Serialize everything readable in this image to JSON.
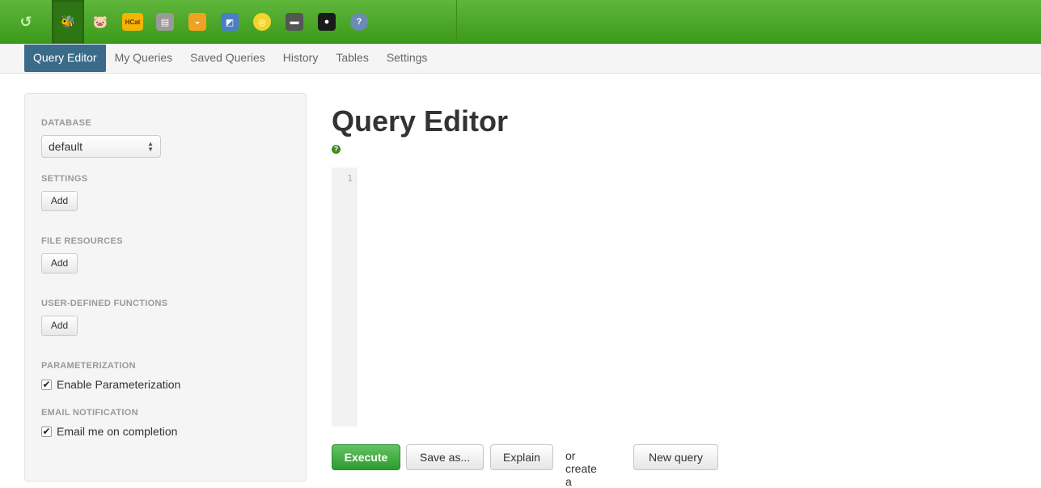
{
  "app_icons": [
    {
      "name": "hue-logo-icon",
      "glyph": "↺",
      "color": "#2e7514"
    },
    {
      "name": "beeswax-icon",
      "glyph": "🐝",
      "color": "#f2c500",
      "active": true
    },
    {
      "name": "pig-icon",
      "glyph": "🐷",
      "color": "#f59fb8"
    },
    {
      "name": "hcat-icon",
      "glyph": "HCat",
      "color": "#f5b400"
    },
    {
      "name": "file-browser-icon",
      "glyph": "▤",
      "color": "#9a9a9a"
    },
    {
      "name": "job-designer-icon",
      "glyph": "◒",
      "color": "#f1a21f"
    },
    {
      "name": "oozie-icon",
      "glyph": "◩",
      "color": "#4a7fc5"
    },
    {
      "name": "job-browser-icon",
      "glyph": "◎",
      "color": "#f3d42c"
    },
    {
      "name": "shell-icon",
      "glyph": "▬",
      "color": "#555555"
    },
    {
      "name": "user-admin-icon",
      "glyph": "●",
      "color": "#1a1a1a"
    },
    {
      "name": "help-icon",
      "glyph": "?",
      "color": "#6a8bb5"
    }
  ],
  "nav": {
    "tabs": [
      "Query Editor",
      "My Queries",
      "Saved Queries",
      "History",
      "Tables",
      "Settings"
    ],
    "active_index": 0
  },
  "sidebar": {
    "database_label": "DATABASE",
    "database_value": "default",
    "settings_label": "SETTINGS",
    "settings_add": "Add",
    "file_resources_label": "FILE RESOURCES",
    "file_resources_add": "Add",
    "udf_label": "USER-DEFINED FUNCTIONS",
    "udf_add": "Add",
    "parameterization_label": "PARAMETERIZATION",
    "parameterization_option": "Enable Parameterization",
    "parameterization_checked": true,
    "email_label": "EMAIL NOTIFICATION",
    "email_option": "Email me on completion",
    "email_checked": true
  },
  "main": {
    "title": "Query Editor",
    "editor_line_number": "1",
    "execute_label": "Execute",
    "save_as_label": "Save as...",
    "explain_label": "Explain",
    "or_create_text": "or create a",
    "new_query_label": "New query"
  },
  "colors": {
    "topbar_green": "#4caf2a",
    "active_tab": "#3a6c8a",
    "execute_green": "#39a339"
  }
}
